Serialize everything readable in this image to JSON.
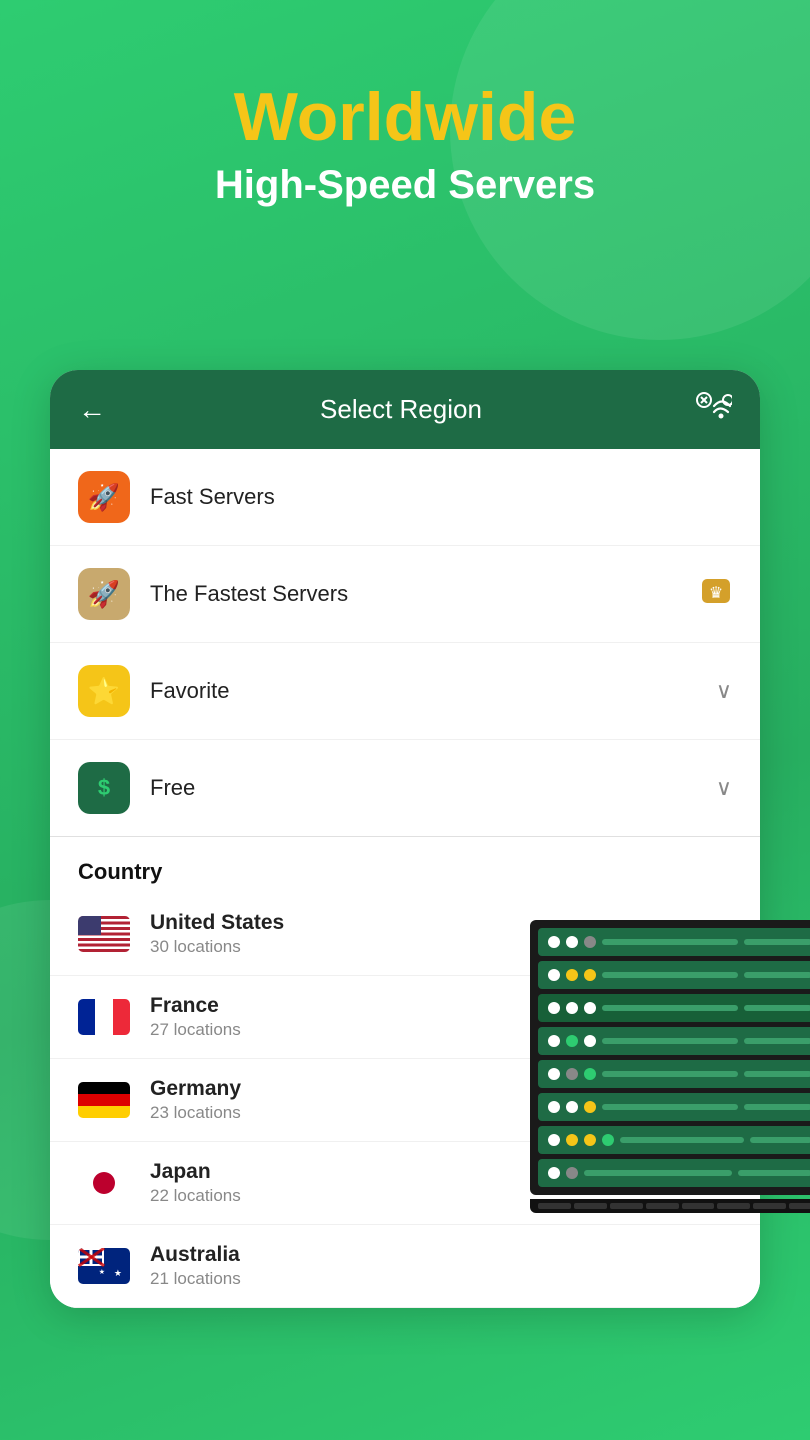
{
  "header": {
    "title": "Worldwide",
    "subtitle": "High-Speed Servers"
  },
  "card": {
    "back_label": "←",
    "title": "Select Region",
    "wifi_icon": "wifi-search"
  },
  "menu": {
    "items": [
      {
        "id": "fast-servers",
        "label": "Fast Servers",
        "icon_color": "orange",
        "icon": "🚀",
        "right": ""
      },
      {
        "id": "fastest-servers",
        "label": "The Fastest Servers",
        "icon_color": "tan",
        "icon": "🚀",
        "right": "crown"
      },
      {
        "id": "favorite",
        "label": "Favorite",
        "icon_color": "yellow",
        "icon": "⭐",
        "right": "chevron"
      },
      {
        "id": "free",
        "label": "Free",
        "icon_color": "green",
        "icon": "💲",
        "right": "chevron"
      }
    ]
  },
  "country_section": {
    "label": "Country",
    "countries": [
      {
        "id": "us",
        "name": "United States",
        "locations": "30 locations",
        "flag": "us"
      },
      {
        "id": "fr",
        "name": "France",
        "locations": "27 locations",
        "flag": "fr"
      },
      {
        "id": "de",
        "name": "Germany",
        "locations": "23 locations",
        "flag": "de"
      },
      {
        "id": "jp",
        "name": "Japan",
        "locations": "22 locations",
        "flag": "jp"
      },
      {
        "id": "au",
        "name": "Australia",
        "locations": "21 locations",
        "flag": "au"
      }
    ]
  }
}
